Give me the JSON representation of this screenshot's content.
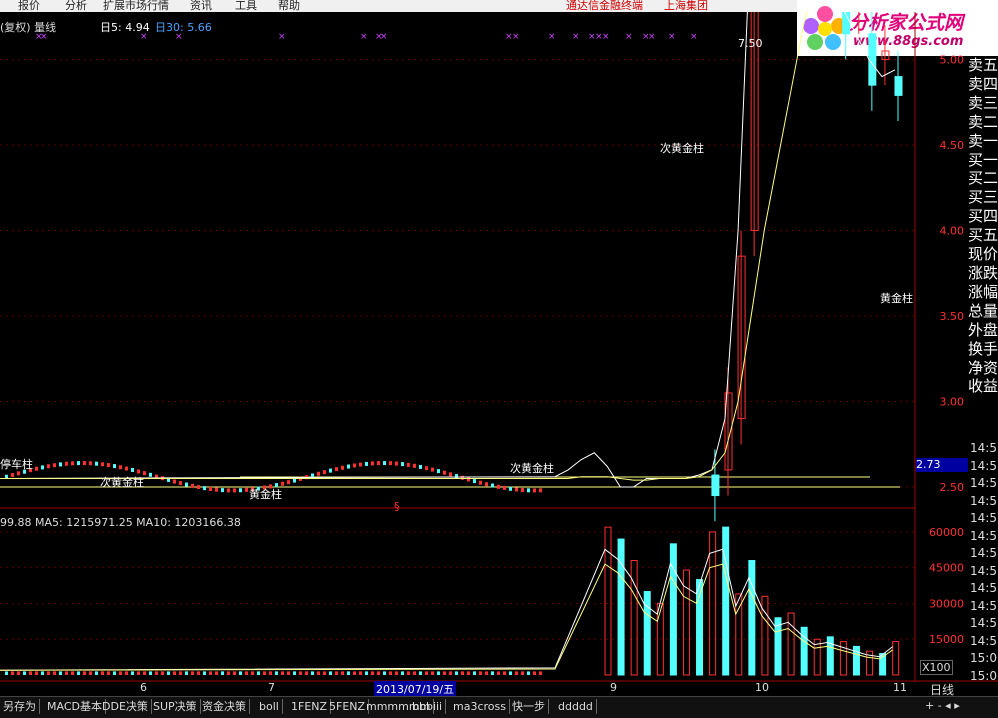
{
  "menu": {
    "items": [
      "报价",
      "分析",
      "扩展市场行情",
      "资讯",
      "工具",
      "帮助"
    ],
    "broker": "通达信金融终端",
    "group": "上海集团"
  },
  "logo": {
    "name": "分析家公式网",
    "url": "www.88gs.com"
  },
  "main_legend": {
    "title": "(复权) 量线",
    "ma5": "日5: 4.94",
    "ma30": "日30: 5.66"
  },
  "volume_legend": {
    "text": "99.88  MA5: 1215971.25  MA10: 1203166.38"
  },
  "annotations": {
    "peak": "7.50",
    "gold_lower": "黄金柱",
    "gold_right": "黄金柱",
    "sub_gold_top": "次黄金柱",
    "sub_gold_left": "次黄金柱",
    "sub_gold_mid": "次黄金柱",
    "parking": "停车柱",
    "marker": "§",
    "current_price": "2.73",
    "scale": "X100"
  },
  "right_panel": [
    "卖五",
    "卖四",
    "卖三",
    "卖二",
    "卖一",
    "买一",
    "买二",
    "买三",
    "买四",
    "买五",
    "现价",
    "涨跌",
    "涨幅",
    "总量",
    "外盘",
    "换手",
    "净资",
    "收益"
  ],
  "time_col": [
    "14:5",
    "14:5",
    "14:5",
    "14:5",
    "14:5",
    "14:5",
    "14:5",
    "14:5",
    "14:5",
    "14:5",
    "14:5",
    "14:5",
    "15:0",
    "15:0"
  ],
  "x_axis": {
    "labels": [
      "6",
      "7",
      "2013/07/19/五",
      "9",
      "10",
      "11"
    ],
    "period": "日线"
  },
  "toolbar": [
    "另存为",
    "MACD基本",
    "DDE决策",
    "SUP决策",
    "资金决策",
    "boll",
    "1FENZ",
    "5FENZ",
    "mmmmmm",
    "bbbiii",
    "ma3cross",
    "快一步",
    "ddddd"
  ],
  "colors": {
    "up": "#ff3030",
    "down": "#54ffff",
    "ma5": "#ffffff",
    "ma10": "#ffff80",
    "gold": "#ffcc00"
  },
  "chart_data": [
    {
      "type": "candlestick",
      "ylim": [
        2.4,
        7.6
      ],
      "y_ticks": [
        "2.50",
        "3.00",
        "3.50",
        "4.00",
        "4.50",
        "5.00",
        "5.50",
        "6.00",
        "6.50",
        "7.00"
      ],
      "series": [
        {
          "name": "日5",
          "values": [
            2.56,
            2.6,
            2.66,
            2.7,
            2.62,
            2.5,
            2.5,
            2.55,
            2.55,
            2.55,
            2.55,
            2.57,
            2.6,
            2.9,
            4.0,
            5.8,
            6.65,
            6.4,
            6.55,
            6.2,
            6.0,
            5.6,
            5.3,
            5.15,
            5.0,
            4.9,
            4.94
          ]
        },
        {
          "name": "日30",
          "values": [
            2.55,
            2.55,
            2.56,
            2.56,
            2.56,
            2.55,
            2.54,
            2.54,
            2.55,
            2.55,
            2.55,
            2.56,
            2.6,
            2.7,
            3.0,
            3.5,
            4.0,
            4.4,
            4.8,
            5.2,
            5.5,
            5.75,
            5.85,
            5.85,
            5.8,
            5.7,
            5.66
          ]
        }
      ],
      "peak": 7.5
    },
    {
      "type": "bar",
      "ylim": [
        0,
        65000
      ],
      "y_ticks": [
        "15000",
        "30000",
        "45000",
        "60000"
      ],
      "values": [
        62000,
        57000,
        48000,
        35000,
        30000,
        55000,
        44000,
        40000,
        60000,
        62000,
        34000,
        48000,
        33000,
        24000,
        26000,
        20000,
        15000,
        16000,
        14000,
        12000,
        10000,
        9000,
        14000,
        17000,
        12000,
        11000,
        13000
      ]
    }
  ]
}
